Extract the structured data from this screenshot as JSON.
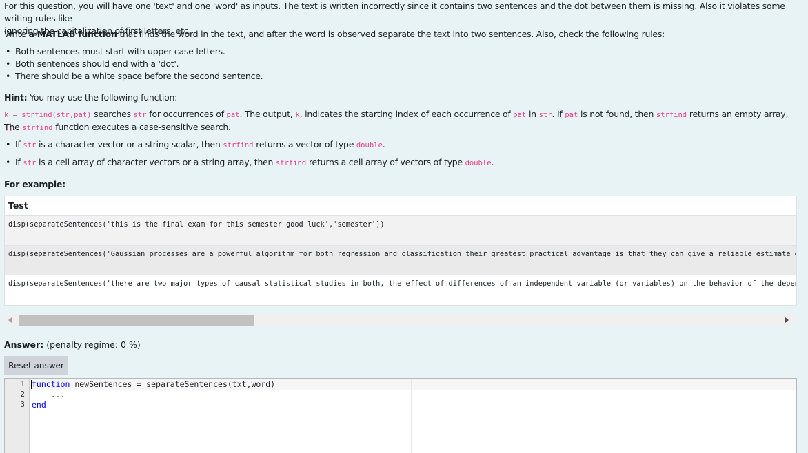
{
  "intro": {
    "line1": "For this question, you will have one 'text' and one 'word' as inputs. The text is written incorrectly since it contains two sentences and the dot between them is missing. Also it violates some writing rules like",
    "line2": "ignoring the capitalization of first letters, etc."
  },
  "task": {
    "pre": "Write ",
    "bold": "a MATLAB function",
    "post": " that finds the word in the text, and after the word is observed separate the text into two sentences. Also, check the following rules:"
  },
  "rules": [
    "Both sentences must start with upper-case letters.",
    "Both sentences should end with a 'dot'.",
    "There should be a white space before the second sentence."
  ],
  "hint": {
    "label": "Hint:",
    "text": " You may use the following function:",
    "sig": "k = strfind(str,pat)",
    "t1": " searches ",
    "c1": "str",
    "t2": " for occurrences of ",
    "c2": "pat",
    "t3": ". The output, ",
    "c3": "k",
    "t4": ", indicates the starting index of each occurrence of ",
    "c4": "pat",
    "t5": " in ",
    "c5": "str",
    "t6": ". If ",
    "c6": "pat",
    "t7": " is not found, then ",
    "c7": "strfind",
    "t8": " returns an empty array, ",
    "c8": "[]",
    "t9": ".",
    "l2pre": "The ",
    "l2code": "strfind",
    "l2post": " function executes a case-sensitive search."
  },
  "cases": [
    {
      "p1": "If ",
      "c1": "str",
      "p2": " is a character vector or a string scalar, then ",
      "c2": "strfind",
      "p3": " returns a vector of type ",
      "c3": "double",
      "p4": "."
    },
    {
      "p1": "If ",
      "c1": "str",
      "p2": " is a cell array of character vectors or a string array, then ",
      "c2": "strfind",
      "p3": " returns a cell array of vectors of type ",
      "c3": "double",
      "p4": "."
    }
  ],
  "example_label": "For example:",
  "table": {
    "header": "Test",
    "rows": [
      "disp(separateSentences('this is the final exam for this semester good luck','semester'))",
      "disp(separateSentences('Gaussian processes are a powerful algorithm for both regression and classification their greatest practical advantage is that they can give a reliable estimate of their own uncertainty','classification'))",
      "disp(separateSentences('there are two major types of causal statistical studies in both, the effect of differences of an independent variable (or variables) on the behavior of the dependent variable are observed','studies'))"
    ]
  },
  "answer": {
    "label": "Answer:",
    "penalty": "(penalty regime: 0 %)"
  },
  "reset_label": "Reset answer",
  "editor": {
    "line_numbers": [
      "1",
      "2",
      "3"
    ],
    "line1_kw": "function",
    "line1_rest": " newSentences = separateSentences(txt,word)",
    "line2": "    ...",
    "line3_kw": "end"
  }
}
